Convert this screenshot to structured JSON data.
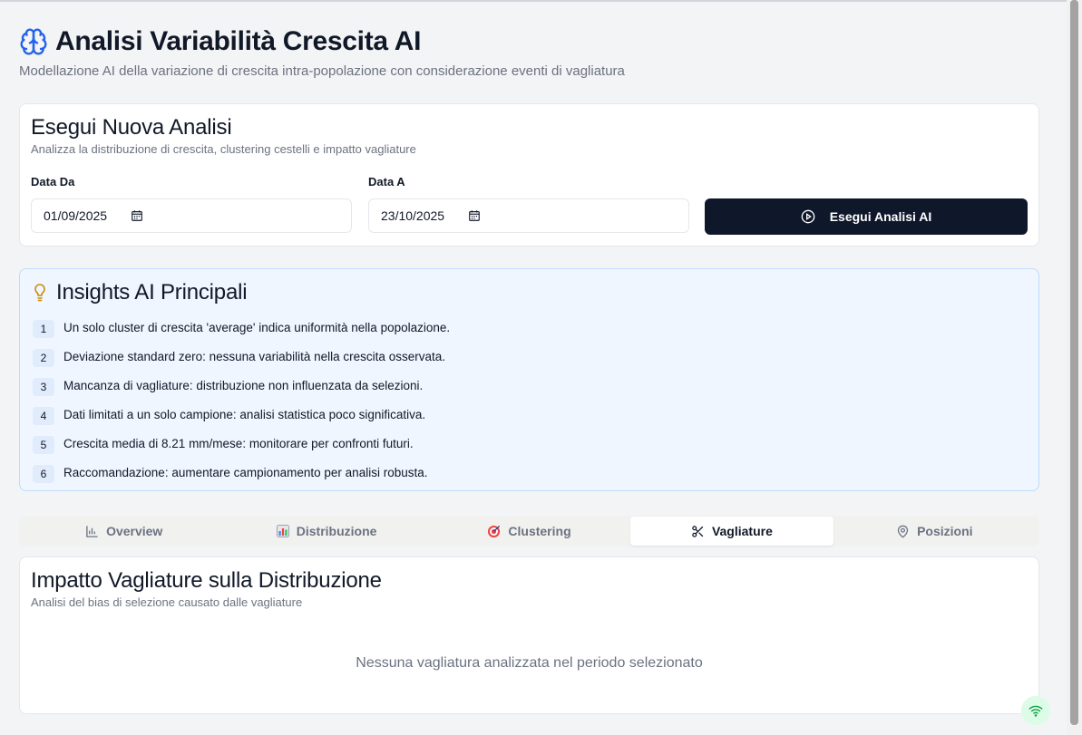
{
  "header": {
    "icon": "brain-icon",
    "title": "Analisi Variabilità Crescita AI",
    "subtitle": "Modellazione AI della variazione di crescita intra-popolazione con considerazione eventi di vagliatura"
  },
  "run_card": {
    "title": "Esegui Nuova Analisi",
    "subtitle": "Analizza la distribuzione di crescita, clustering cestelli e impatto vagliature",
    "date_from_label": "Data Da",
    "date_from_value": "01/09/2025",
    "date_to_label": "Data A",
    "date_to_value": "23/10/2025",
    "run_button_label": "Esegui Analisi AI"
  },
  "insights": {
    "icon": "lightbulb-icon",
    "title": "Insights AI Principali",
    "items": [
      {
        "num": "1",
        "text": "Un solo cluster di crescita 'average' indica uniformità nella popolazione."
      },
      {
        "num": "2",
        "text": "Deviazione standard zero: nessuna variabilità nella crescita osservata."
      },
      {
        "num": "3",
        "text": "Mancanza di vagliature: distribuzione non influenzata da selezioni."
      },
      {
        "num": "4",
        "text": "Dati limitati a un solo campione: analisi statistica poco significativa."
      },
      {
        "num": "5",
        "text": "Crescita media di 8.21 mm/mese: monitorare per confronti futuri."
      },
      {
        "num": "6",
        "text": "Raccomandazione: aumentare campionamento per analisi robusta."
      }
    ]
  },
  "tabs": [
    {
      "label": "Overview",
      "icon": "bar-chart-icon",
      "active": false
    },
    {
      "label": "Distribuzione",
      "icon": "chart-emoji-icon",
      "active": false
    },
    {
      "label": "Clustering",
      "icon": "target-icon",
      "active": false
    },
    {
      "label": "Vagliature",
      "icon": "scissors-icon",
      "active": true
    },
    {
      "label": "Posizioni",
      "icon": "map-pin-icon",
      "active": false
    }
  ],
  "impact_card": {
    "title": "Impatto Vagliature sulla Distribuzione",
    "subtitle": "Analisi del bias di selezione causato dalle vagliature",
    "empty_message": "Nessuna vagliatura analizzata nel periodo selezionato"
  },
  "status": {
    "icon": "wifi-icon",
    "color": "#16a34a"
  },
  "colors": {
    "accent": "#2563eb",
    "button_bg": "#0f172a",
    "insights_bg": "#eff6ff"
  }
}
